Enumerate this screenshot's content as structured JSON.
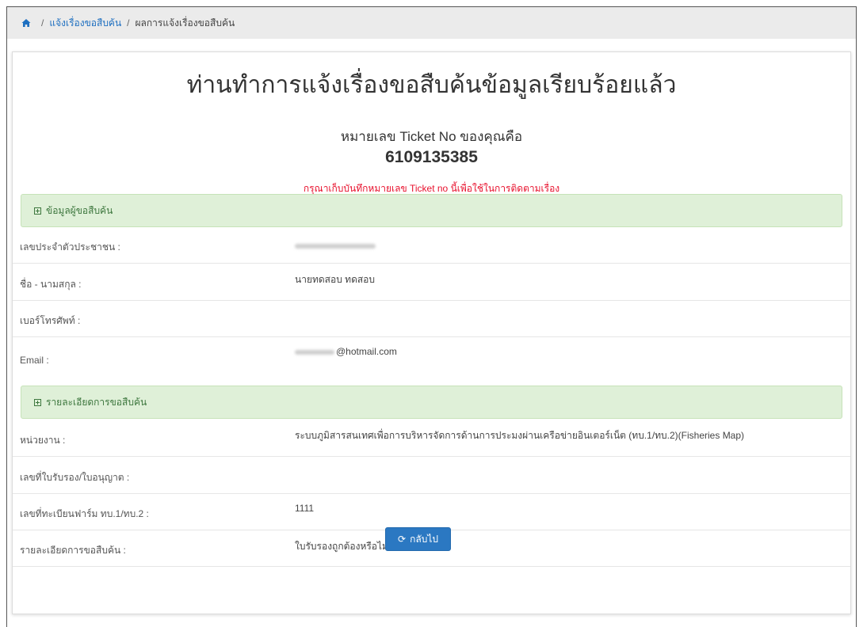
{
  "breadcrumb": {
    "items": [
      "แจ้งเรื่องขอสืบค้น",
      "ผลการแจ้งเรื่องขอสืบค้น"
    ]
  },
  "result": {
    "title": "ท่านทำการแจ้งเรื่องขอสืบค้นข้อมูลเรียบร้อยแล้ว",
    "ticket_label": "หมายเลข Ticket No ของคุณคือ",
    "ticket_no": "6109135385",
    "warning": "กรุณาเก็บบันทึกหมายเลข Ticket no นี้เพื่อใช้ในการติดตามเรื่อง"
  },
  "requester": {
    "header": "ข้อมูลผู้ขอสืบค้น",
    "fields": [
      {
        "label": "เลขประจำตัวประชาชน :",
        "value": ""
      },
      {
        "label": "ชื่อ - นามสกุล :",
        "value": "นายทดสอบ ทดสอบ"
      },
      {
        "label": "เบอร์โทรศัพท์ :",
        "value": ""
      },
      {
        "label": "Email :",
        "value": "@hotmail.com"
      }
    ]
  },
  "request": {
    "header": "รายละเอียดการขอสืบค้น",
    "fields": [
      {
        "label": "หน่วยงาน :",
        "value": "ระบบภูมิสารสนเทศเพื่อการบริหารจัดการด้านการประมงผ่านเครือข่ายอินเตอร์เน็ต (ทบ.1/ทบ.2)(Fisheries Map)"
      },
      {
        "label": "เลขที่ใบรับรอง/ใบอนุญาต :",
        "value": ""
      },
      {
        "label": "เลขที่ทะเบียนฟาร์ม ทบ.1/ทบ.2 :",
        "value": "1111"
      },
      {
        "label": "รายละเอียดการขอสืบค้น :",
        "value": "ใบรับรองถูกต้องหรือไม่?"
      }
    ]
  },
  "actions": {
    "back_label": "กลับไป"
  },
  "colors": {
    "link": "#1e6fc0",
    "section_bg": "#dff0d8",
    "section_text": "#3c763d",
    "warning": "#e8112d",
    "button": "#2b78c2"
  },
  "icons": {
    "home": "home-icon",
    "section": "plus-square-icon",
    "back": "refresh-icon"
  }
}
